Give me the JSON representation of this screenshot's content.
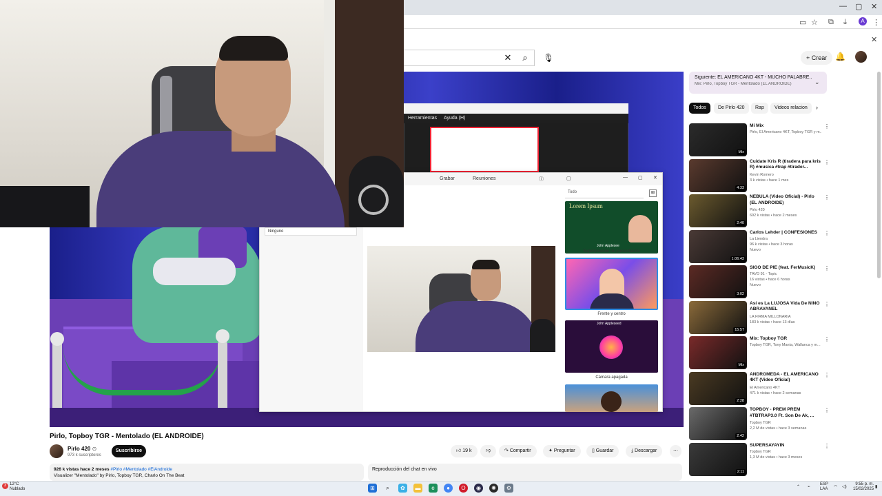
{
  "app_menu": {
    "tools": "Herramientas",
    "help": "Ayuda (H)"
  },
  "teams": {
    "toolbar_record": "Grabar",
    "toolbar_meetings": "Reuniones",
    "background_select": "Ninguno",
    "template_search_placeholder": "Todo",
    "templates": [
      {
        "label": "Superposición de presentación",
        "inner_title": "Lorem Ipsum",
        "inner_name": "John Applesee"
      },
      {
        "label": "Frente y centro"
      },
      {
        "label": "Cámara apagada",
        "inner_name": "John Appleseed"
      }
    ]
  },
  "youtube": {
    "create_label": "Crear",
    "video": {
      "title": "Pirlo, Topboy TGR - Mentolado (EL ANDROIDE)",
      "channel": "Pirlo 420",
      "subscribers": "973 k suscriptores",
      "subscribe_label": "Suscribirse",
      "likes": "19 k",
      "share_label": "Compartir",
      "ask_label": "Preguntar",
      "save_label": "Guardar",
      "download_label": "Descargar",
      "desc_stats": "926 k vistas  hace 2 meses",
      "desc_tags": "#Pirlo #Mentolado #ElAndroide",
      "desc_line2": "Visualizer \"Mentolado\" by Pirlo, Topboy TGR, Charlo On The Beat",
      "chat_replay": "Reproducción del chat en vivo"
    },
    "up_next": {
      "title": "Siguiente: EL AMERICANO 4KT - MUCHO PALABRE...",
      "sub": "Mix: Pirlo, Topboy TGR - Mentolado (EL ANDROIDE)"
    },
    "chips": [
      "Todos",
      "De Pirlo 420",
      "Rap",
      "Videos relacion"
    ],
    "recommendations": [
      {
        "title": "Mi Mix",
        "channel": "Pirlo, El Americano 4KT, Topboy TGR y m...",
        "meta": "",
        "duration": "Mix",
        "tag": "",
        "thumb": "#2b2b2b"
      },
      {
        "title": "Cuidate Kris R (tiradera para kris R) #musica #trap #tirader...",
        "channel": "Kevin Romero",
        "meta": "3 k vistas • hace 1 mes",
        "duration": "4:33",
        "tag": "",
        "thumb": "#5a3a2e"
      },
      {
        "title": "NEBULA (Video Oficial) - Pirlo (EL ANDROIDE)",
        "channel": "Pirlo 420",
        "meta": "692 k vistas • hace 2 meses",
        "duration": "2:40",
        "tag": "",
        "thumb": "#6b5a2e"
      },
      {
        "title": "Carlos Lehder | CONFESIONES",
        "channel": "La Liendra",
        "meta": "96 k vistas • hace 3 horas",
        "duration": "1:06:43",
        "tag": "Nuevo",
        "thumb": "#4a3a36"
      },
      {
        "title": "SIGO DE PIE (feat. FerMusicK)",
        "channel": "TAVO 91 - Topic",
        "meta": "16 vistas • hace 6 horas",
        "duration": "3:02",
        "tag": "Nuevo",
        "thumb": "#5c2a24"
      },
      {
        "title": "Así es La LUJOSA Vida De NINO ABRAVANEL",
        "channel": "LA FIRMA MILLONARIA",
        "meta": "183 k vistas • hace 13 días",
        "duration": "15:57",
        "tag": "",
        "thumb": "#8a6a3a"
      },
      {
        "title": "Mix: Topboy TGR",
        "channel": "Topboy TGR, Tony Manta, Wallanca y m...",
        "meta": "",
        "duration": "Mix",
        "tag": "",
        "thumb": "#7a2a2a"
      },
      {
        "title": "ANDROMEDA - EL AMERICANO 4KT (Video Oficial)",
        "channel": "El Americano 4KT",
        "meta": "471 k vistas • hace 2 semanas",
        "duration": "2:28",
        "tag": "",
        "thumb": "#4a3a22"
      },
      {
        "title": "TOPBOY - PREM PREM #TBTRAP3.0 Ft. Son De Ak, ...",
        "channel": "Topboy TGR",
        "meta": "2,2 M de vistas • hace 3 semanas",
        "duration": "2:42",
        "tag": "",
        "thumb": "#6a6a6a"
      },
      {
        "title": "SUPERSAYAYIN",
        "channel": "Topboy TGR",
        "meta": "1,3 M de vistas • hace 3 meses",
        "duration": "2:11",
        "tag": "",
        "thumb": "#3a3a3a"
      }
    ]
  },
  "taskbar": {
    "temp": "12°C",
    "weather": "Nublado",
    "notif_count": "3",
    "lang": "ESP",
    "region": "LAA",
    "time": "9:55 p. m.",
    "date": "15/02/2025"
  },
  "colors": {
    "accent_purple": "#6b3fb5",
    "youtube_black": "#0f0f0f",
    "curtain_blue": "#2b2fa8"
  }
}
